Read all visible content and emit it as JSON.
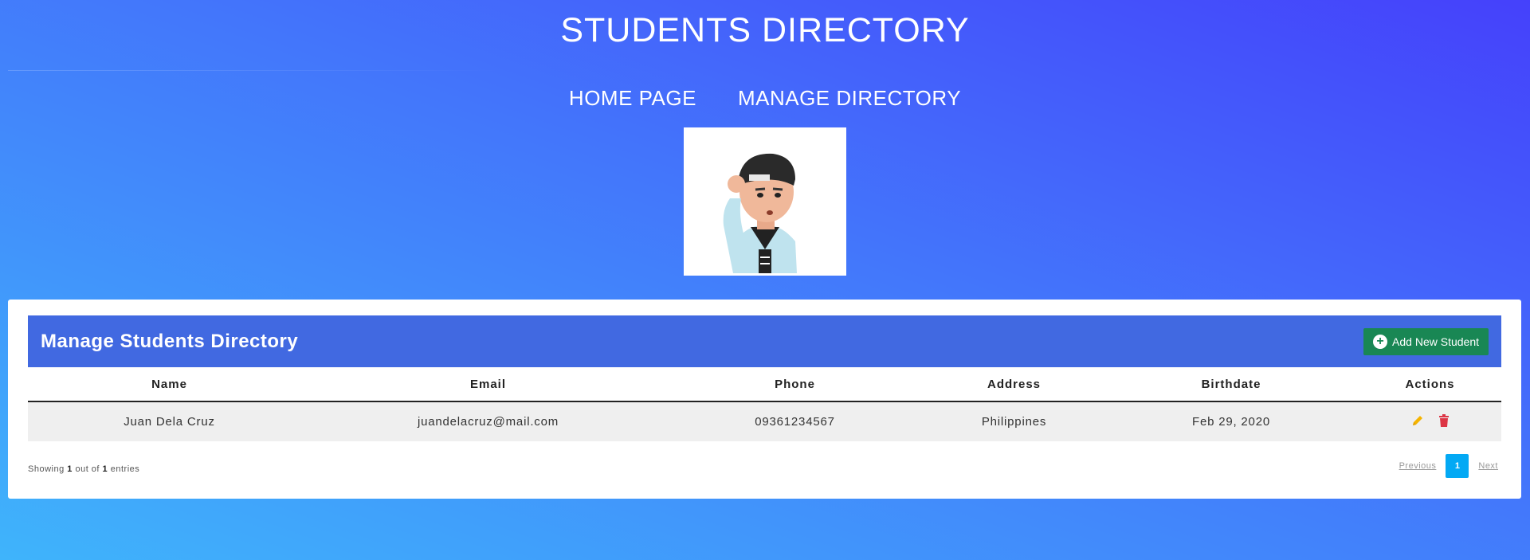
{
  "site": {
    "title": "STUDENTS DIRECTORY"
  },
  "nav": {
    "items": [
      {
        "label": "HOME PAGE"
      },
      {
        "label": "MANAGE DIRECTORY"
      }
    ]
  },
  "panel": {
    "title": "Manage Students Directory",
    "add_button_label": "Add New Student"
  },
  "table": {
    "columns": [
      "Name",
      "Email",
      "Phone",
      "Address",
      "Birthdate",
      "Actions"
    ],
    "rows": [
      {
        "name": "Juan Dela Cruz",
        "email": "juandelacruz@mail.com",
        "phone": "09361234567",
        "address": "Philippines",
        "birthdate": "Feb 29, 2020"
      }
    ]
  },
  "footer": {
    "showing_prefix": "Showing",
    "showing_count": "1",
    "showing_mid": "out of",
    "showing_total": "1",
    "showing_suffix": "entries"
  },
  "pagination": {
    "previous": "Previous",
    "current_page": "1",
    "next": "Next"
  },
  "colors": {
    "header_bar": "#4169e1",
    "add_button": "#198754",
    "edit_icon": "#f5b400",
    "delete_icon": "#dc3545",
    "page_active": "#03a9f4"
  },
  "icons": {
    "add": "plus-circle-icon",
    "edit": "pencil-icon",
    "delete": "trash-icon"
  }
}
